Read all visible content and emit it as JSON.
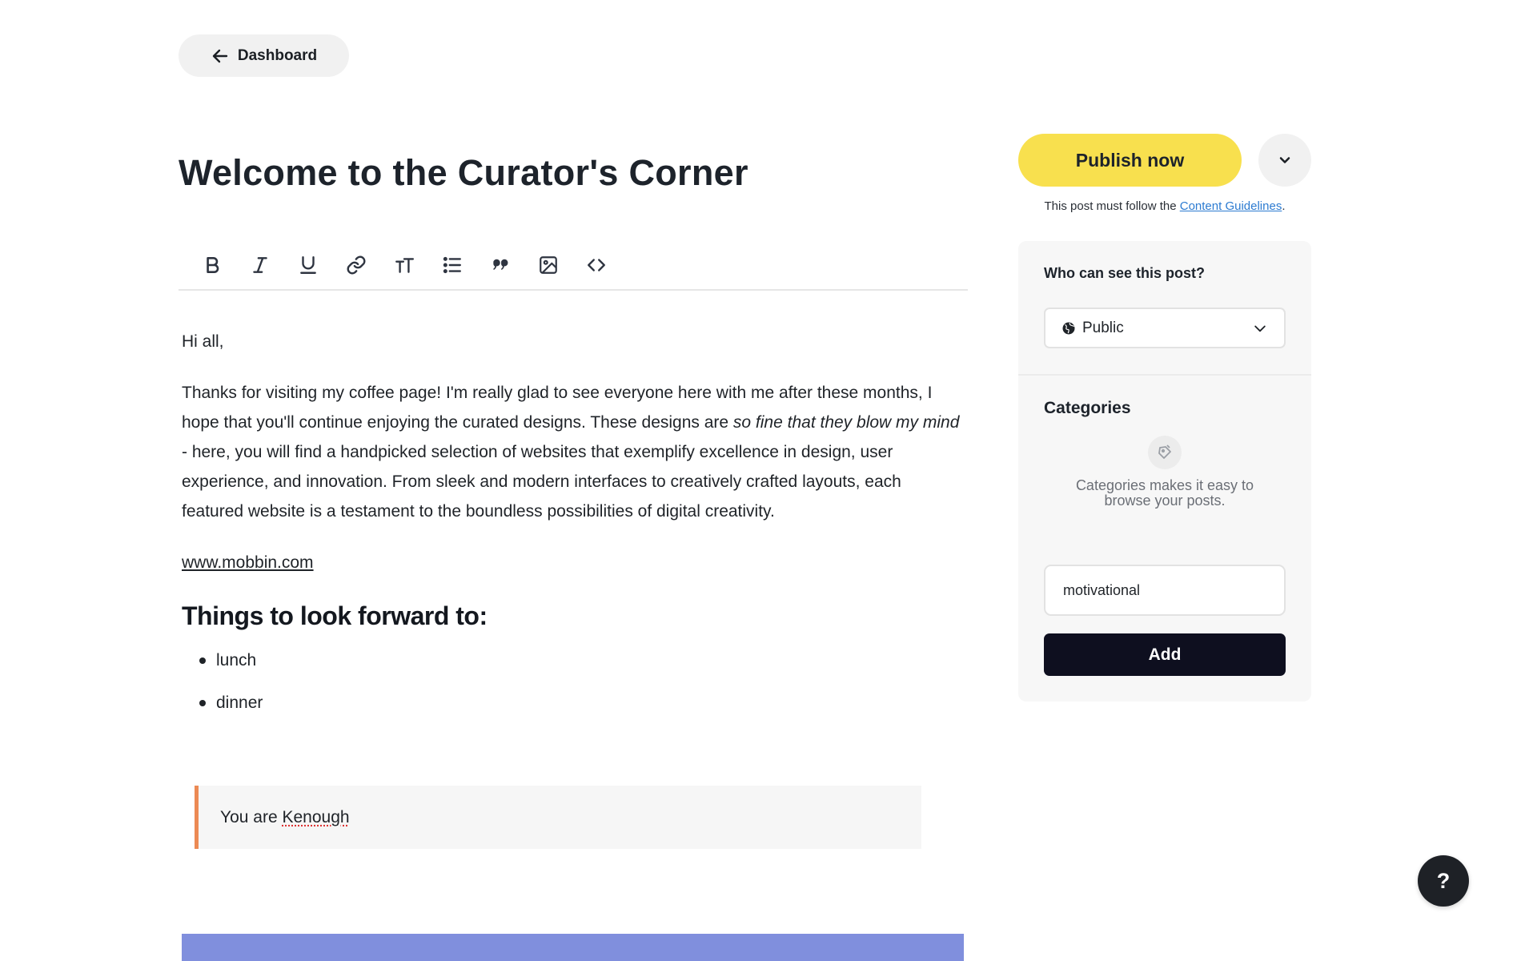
{
  "nav": {
    "back_label": "Dashboard"
  },
  "post": {
    "title": "Welcome to the Curator's Corner",
    "greeting": "Hi all,",
    "para_before_italic": "Thanks for visiting my coffee page! I'm really glad to see everyone here with me after these months, I hope that you'll continue enjoying the curated designs. These designs are ",
    "para_italic": "so fine that they blow my mind",
    "para_after_italic": " - here, you will find a handpicked selection of websites that exemplify excellence in design, user experience, and innovation. From sleek and modern interfaces to creatively crafted layouts, each featured website is a testament to the boundless possibilities of digital creativity.",
    "link": "www.mobbin.com",
    "heading": "Things to look forward to:",
    "list_items": [
      "lunch",
      "dinner"
    ],
    "quote_prefix": "You are ",
    "quote_word": "Kenough"
  },
  "toolbar": {
    "icons": [
      "bold-icon",
      "italic-icon",
      "underline-icon",
      "link-icon",
      "text-size-icon",
      "list-icon",
      "quote-icon",
      "image-icon",
      "code-icon"
    ]
  },
  "sidebar": {
    "publish_label": "Publish now",
    "note_prefix": "This post must follow the ",
    "note_link": "Content Guidelines",
    "note_suffix": ".",
    "visibility_label": "Who can see this post?",
    "visibility_value": "Public",
    "categories_label": "Categories",
    "categories_help": "Categories makes it easy to browse your posts.",
    "category_input_value": "motivational",
    "add_label": "Add"
  },
  "help": {
    "label": "?"
  },
  "colors": {
    "publish": "#f8e04e",
    "add_button": "#0e0f1f",
    "quote_border": "#ec8a54",
    "link": "#2c7bd1",
    "banner": "#808fdd"
  }
}
